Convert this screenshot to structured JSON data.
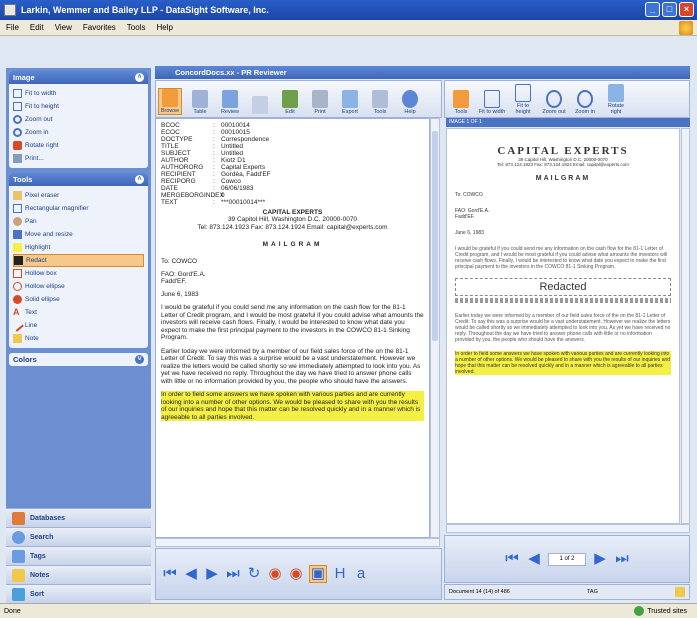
{
  "window": {
    "title": "Larkin, Wemmer and Bailey LLP - DataSight Software, Inc.",
    "controls": [
      "_",
      "□",
      "×"
    ]
  },
  "menu": [
    "File",
    "Edit",
    "View",
    "Favorites",
    "Tools",
    "Help"
  ],
  "sidebar": {
    "image_panel": {
      "title": "Image",
      "items": [
        {
          "label": "Fit to width",
          "icon": "fit-width-icon"
        },
        {
          "label": "Fit to height",
          "icon": "fit-height-icon"
        },
        {
          "label": "Zoom out",
          "icon": "zoom-out-icon"
        },
        {
          "label": "Zoom in",
          "icon": "zoom-in-icon"
        },
        {
          "label": "Rotate right",
          "icon": "rotate-right-icon"
        },
        {
          "label": "Print...",
          "icon": "print-icon"
        }
      ]
    },
    "tools_panel": {
      "title": "Tools",
      "items": [
        {
          "label": "Pixel eraser",
          "icon": "eraser-icon"
        },
        {
          "label": "Rectangular magnifier",
          "icon": "magnifier-icon"
        },
        {
          "label": "Pan",
          "icon": "pan-icon"
        },
        {
          "label": "Move and resize",
          "icon": "move-icon"
        },
        {
          "label": "Highlight",
          "icon": "highlight-icon"
        },
        {
          "label": "Redact",
          "icon": "redact-icon",
          "active": true
        },
        {
          "label": "Hollow box",
          "icon": "hollow-box-icon"
        },
        {
          "label": "Hollow ellipse",
          "icon": "hollow-ellipse-icon"
        },
        {
          "label": "Solid ellipse",
          "icon": "solid-ellipse-icon"
        },
        {
          "label": "Text",
          "icon": "text-icon"
        },
        {
          "label": "Line",
          "icon": "line-icon"
        },
        {
          "label": "Note",
          "icon": "note-icon"
        }
      ]
    },
    "colors_panel": {
      "title": "Colors"
    },
    "nav": [
      {
        "label": "Databases",
        "color": "#e07a3a"
      },
      {
        "label": "Search",
        "color": "#6b9be0"
      },
      {
        "label": "Tags",
        "color": "#6b9be0"
      },
      {
        "label": "Notes",
        "color": "#f2c84a"
      },
      {
        "label": "Sort",
        "color": "#4aa0d8"
      }
    ]
  },
  "viewer": {
    "title": "ConcordDocs.xx - PR Reviewer",
    "left_toolbar": [
      "Browse",
      "Table",
      "Review",
      "",
      "Edit",
      "Print",
      "Export",
      "Tools",
      "Help"
    ],
    "right_toolbar": [
      "Tools",
      "Fit to width",
      "Fit to height",
      "Zoom out",
      "Zoom in",
      "Rotate right"
    ],
    "image_bar": "IMAGE 1 OF 1",
    "fields": [
      {
        "name": "BCOC",
        "value": "00010014"
      },
      {
        "name": "ECOC",
        "value": "00010015"
      },
      {
        "name": "DOCTYPE",
        "value": "Correspondence"
      },
      {
        "name": "TITLE",
        "value": "Untitled"
      },
      {
        "name": "SUBJECT",
        "value": "Untitled"
      },
      {
        "name": "AUTHOR",
        "value": "Kiotz D1"
      },
      {
        "name": "AUTHORORG",
        "value": "Capital Experts"
      },
      {
        "name": "RECIPIENT",
        "value": "Gordéa, Fadd'EF"
      },
      {
        "name": "RECIPORG",
        "value": "Cowco"
      },
      {
        "name": "DATE",
        "value": "06/06/1983"
      },
      {
        "name": "MERGEBORGINDEX",
        "value": "0"
      },
      {
        "name": "TEXT",
        "value": "***00010014***"
      }
    ],
    "letterhead": {
      "company": "CAPITAL EXPERTS",
      "address": "39 Capitol Hill, Washington D.C. 20000-0070",
      "contact": "Tel: 873.124.1923 Fax: 873.124.1924 Email: capital@experts.com"
    },
    "mailgram": "MAILGRAM",
    "to": "To: COWCO",
    "fao": "FAO: Gord'E.A.",
    "fao2": "Fadd'EF.",
    "date_line": "June 6, 1983",
    "para1": "I would be grateful if you could send me any information on the cash flow for the 81-1 Letter of Credit program, and I would be most grateful if you could advise what amounts the investors will receive cash flows. Finally, I would be interested to know what date you expect to make the first principal payment to the investors in the COWCO 81-1 Sinking Program.",
    "para2": "Earlier today we were informed by a member of our field sales force of the on the 81-1 Letter of Credit. To say this was a surprise would be a vast understatement. However we realize the letters would be called shortly so we immediately attempted to look into you. As yet we have received no reply. Throughout the day we have tried to answer phone calls with little or no information provided by you, the people who should have the answers.",
    "para3": "In order to field some answers we have spoken with various parties and are currently looking into a number of other options. We would be pleased to share with you the results of our inquiries and hope that this matter can be resolved quickly and in a manner which is agreeable to all parties involved.",
    "page_image": {
      "company": "CAPITAL EXPERTS",
      "address": "39 Capitol Hill, Washington D.C. 20000-0070",
      "contact": "Tel: 873.124.1923 Fax: 873.124.1924 Email: capital@experts.com",
      "mailgram": "MAILGRAM",
      "to": "To: COWCO",
      "fao": "FAO: Gord'E.A.",
      "fao2": "Fadd'EF.",
      "date": "June 6, 1983",
      "redacted": "Redacted"
    },
    "page_counter": "1 of 2",
    "status_left": "Document 14 (14) of 486",
    "status_tag": "TAG"
  },
  "statusbar": {
    "left": "Done",
    "zone": "Trusted sites"
  }
}
